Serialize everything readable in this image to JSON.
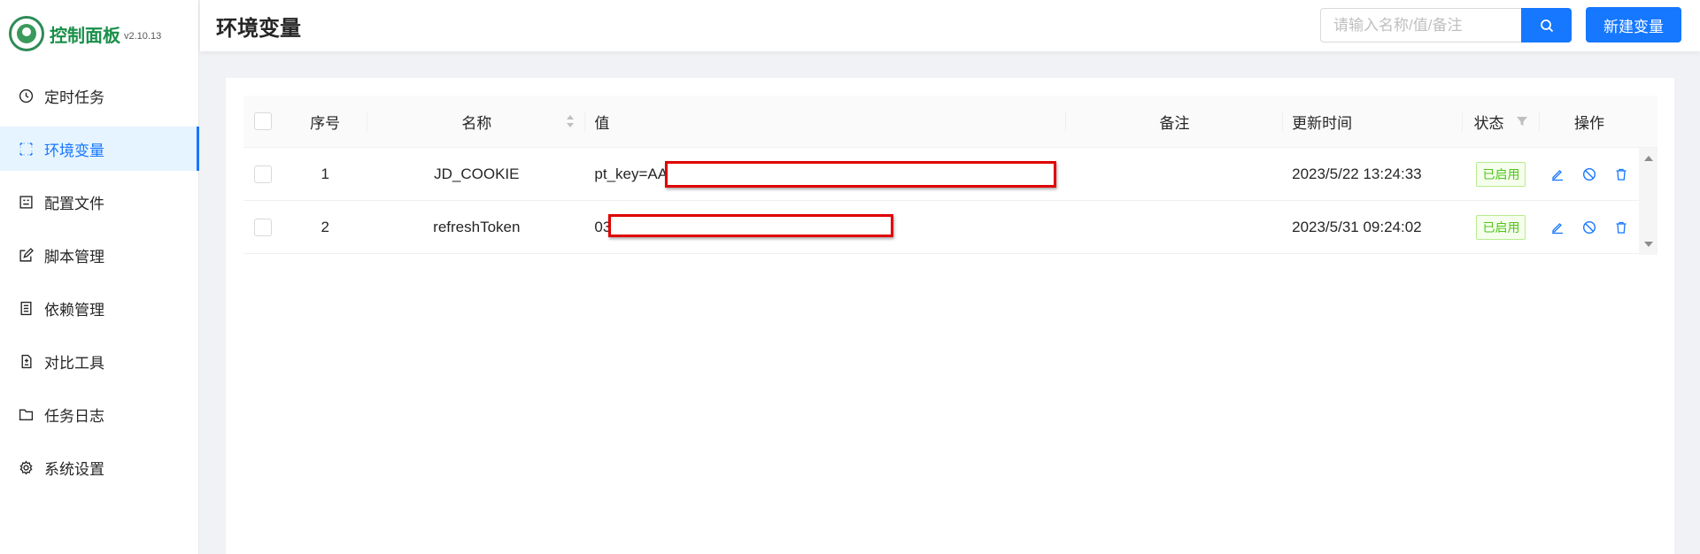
{
  "app": {
    "title": "控制面板",
    "version": "v2.10.13"
  },
  "sidebar": {
    "items": [
      {
        "label": "定时任务",
        "icon": "clock-icon"
      },
      {
        "label": "环境变量",
        "icon": "variable-icon",
        "active": true
      },
      {
        "label": "配置文件",
        "icon": "config-icon"
      },
      {
        "label": "脚本管理",
        "icon": "edit-script-icon"
      },
      {
        "label": "依赖管理",
        "icon": "dependency-icon"
      },
      {
        "label": "对比工具",
        "icon": "diff-icon"
      },
      {
        "label": "任务日志",
        "icon": "folder-icon"
      },
      {
        "label": "系统设置",
        "icon": "gear-icon"
      }
    ]
  },
  "header": {
    "title": "环境变量",
    "search_placeholder": "请输入名称/值/备注",
    "new_button": "新建变量"
  },
  "table": {
    "columns": {
      "index": "序号",
      "name": "名称",
      "value": "值",
      "note": "备注",
      "updated": "更新时间",
      "status": "状态",
      "actions": "操作"
    },
    "rows": [
      {
        "index": "1",
        "name": "JD_COOKIE",
        "value": "pt_key=AA",
        "note": "",
        "updated": "2023/5/22 13:24:33",
        "status": "已启用"
      },
      {
        "index": "2",
        "name": "refreshToken",
        "value": "03",
        "note": "",
        "updated": "2023/5/31 09:24:02",
        "status": "已启用"
      }
    ]
  },
  "colors": {
    "primary": "#1677ff",
    "brand_green": "#1a8f4a",
    "status_green": "#52c41a",
    "redaction": "#e00000"
  }
}
